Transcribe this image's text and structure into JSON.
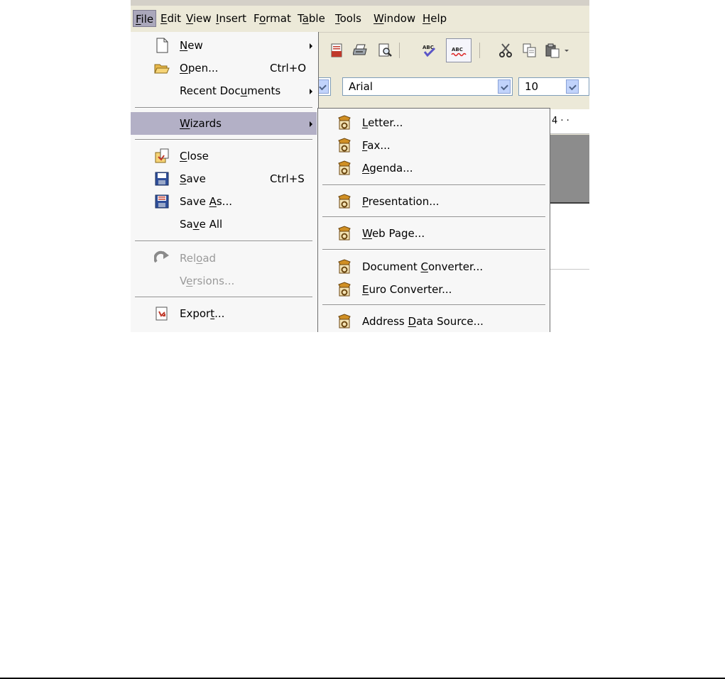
{
  "menubar": {
    "items": [
      {
        "pre": "",
        "u": "F",
        "post": "ile"
      },
      {
        "pre": "",
        "u": "E",
        "post": "dit"
      },
      {
        "pre": "",
        "u": "V",
        "post": "iew"
      },
      {
        "pre": "",
        "u": "I",
        "post": "nsert"
      },
      {
        "pre": "F",
        "u": "o",
        "post": "rmat"
      },
      {
        "pre": "T",
        "u": "a",
        "post": "ble"
      },
      {
        "pre": "",
        "u": "T",
        "post": "ools"
      },
      {
        "pre": "",
        "u": "W",
        "post": "indow"
      },
      {
        "pre": "",
        "u": "H",
        "post": "elp"
      }
    ]
  },
  "formatting": {
    "font_name": "Arial",
    "font_size": "10"
  },
  "ruler": {
    "text": "4 · ·"
  },
  "file_menu": {
    "new": {
      "pre": "",
      "u": "N",
      "post": "ew"
    },
    "open": {
      "pre": "",
      "u": "O",
      "post": "pen...",
      "accel": "Ctrl+O"
    },
    "recent": {
      "pre": "Recent Doc",
      "u": "u",
      "post": "ments"
    },
    "wizards": {
      "pre": "",
      "u": "W",
      "post": "izards"
    },
    "close": {
      "pre": "",
      "u": "C",
      "post": "lose"
    },
    "save": {
      "pre": "",
      "u": "S",
      "post": "ave",
      "accel": "Ctrl+S"
    },
    "save_as": {
      "pre": "Save ",
      "u": "A",
      "post": "s..."
    },
    "save_all": {
      "pre": "Sa",
      "u": "v",
      "post": "e All"
    },
    "reload": {
      "pre": "Rel",
      "u": "o",
      "post": "ad"
    },
    "versions": {
      "pre": "V",
      "u": "e",
      "post": "rsions..."
    },
    "export": {
      "pre": "Expor",
      "u": "t",
      "post": "..."
    }
  },
  "wizards_menu": {
    "letter": {
      "pre": "",
      "u": "L",
      "post": "etter..."
    },
    "fax": {
      "pre": "",
      "u": "F",
      "post": "ax..."
    },
    "agenda": {
      "pre": "",
      "u": "A",
      "post": "genda..."
    },
    "presentation": {
      "pre": "",
      "u": "P",
      "post": "resentation..."
    },
    "web_page": {
      "pre": "",
      "u": "W",
      "post": "eb Page..."
    },
    "document_converter": {
      "pre": "Document ",
      "u": "C",
      "post": "onverter..."
    },
    "euro_converter": {
      "pre": "",
      "u": "E",
      "post": "uro Converter..."
    },
    "address_data_source": {
      "pre": "Address ",
      "u": "D",
      "post": "ata Source..."
    }
  }
}
